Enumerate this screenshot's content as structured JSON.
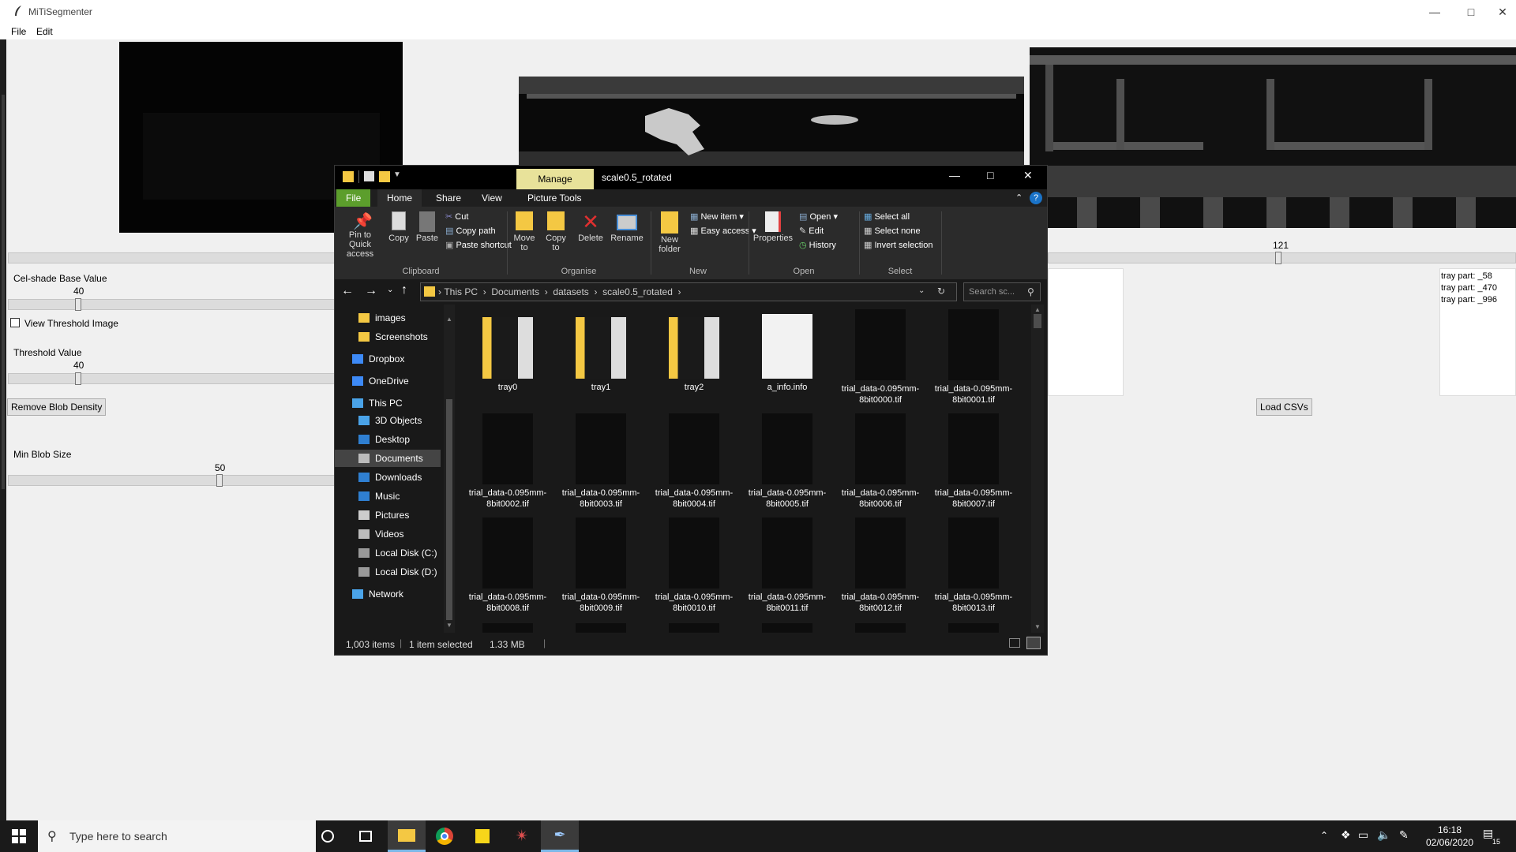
{
  "app": {
    "title": "MiTiSegmenter",
    "menu": [
      "File",
      "Edit"
    ],
    "controls": {
      "top_slider_value": "121",
      "cel_shade_label": "Cel-shade Base Value",
      "cel_shade_value": "40",
      "view_threshold_label": "View Threshold Image",
      "threshold_label": "Threshold Value",
      "threshold_value": "40",
      "remove_blob_button": "Remove Blob Density",
      "min_blob_label": "Min Blob Size",
      "min_blob_value": "50",
      "load_csvs_button": "Load CSVs"
    },
    "tray_parts": [
      "tray part: _58",
      "tray part: _470",
      "tray part: _996"
    ]
  },
  "explorer": {
    "manage_tab": "Manage",
    "title": "scale0.5_rotated",
    "tabs": [
      "File",
      "Home",
      "Share",
      "View",
      "Picture Tools"
    ],
    "ribbon": {
      "clipboard": {
        "pin": "Pin to Quick access",
        "copy": "Copy",
        "paste": "Paste",
        "cut": "Cut",
        "copy_path": "Copy path",
        "paste_shortcut": "Paste shortcut",
        "group": "Clipboard"
      },
      "organise": {
        "move_to": "Move to",
        "copy_to": "Copy to",
        "delete": "Delete",
        "rename": "Rename",
        "group": "Organise"
      },
      "new": {
        "new_folder": "New folder",
        "new_item": "New item",
        "easy_access": "Easy access",
        "group": "New"
      },
      "open": {
        "properties": "Properties",
        "open": "Open",
        "edit": "Edit",
        "history": "History",
        "group": "Open"
      },
      "select": {
        "select_all": "Select all",
        "select_none": "Select none",
        "invert": "Invert selection",
        "group": "Select"
      }
    },
    "breadcrumb": [
      "This PC",
      "Documents",
      "datasets",
      "scale0.5_rotated"
    ],
    "search_placeholder": "Search sc...",
    "nav": [
      {
        "label": "images",
        "icon": "folder-icon",
        "indent": 1
      },
      {
        "label": "Screenshots",
        "icon": "folder-icon",
        "indent": 1
      },
      {
        "label": "Dropbox",
        "icon": "dropbox-icon",
        "indent": 0
      },
      {
        "label": "OneDrive",
        "icon": "onedrive-icon",
        "indent": 0
      },
      {
        "label": "This PC",
        "icon": "pc-icon",
        "indent": 0
      },
      {
        "label": "3D Objects",
        "icon": "cube-icon",
        "indent": 1
      },
      {
        "label": "Desktop",
        "icon": "desktop-icon",
        "indent": 1
      },
      {
        "label": "Documents",
        "icon": "documents-icon",
        "indent": 1,
        "selected": true
      },
      {
        "label": "Downloads",
        "icon": "download-icon",
        "indent": 1
      },
      {
        "label": "Music",
        "icon": "music-icon",
        "indent": 1
      },
      {
        "label": "Pictures",
        "icon": "pictures-icon",
        "indent": 1
      },
      {
        "label": "Videos",
        "icon": "videos-icon",
        "indent": 1
      },
      {
        "label": "Local Disk (C:)",
        "icon": "disk-icon",
        "indent": 1
      },
      {
        "label": "Local Disk (D:)",
        "icon": "disk-icon",
        "indent": 1
      },
      {
        "label": "Network",
        "icon": "network-icon",
        "indent": 0
      }
    ],
    "items": [
      {
        "name": "tray0",
        "kind": "folder"
      },
      {
        "name": "tray1",
        "kind": "folder"
      },
      {
        "name": "tray2",
        "kind": "folder"
      },
      {
        "name": "a_info.info",
        "kind": "file"
      },
      {
        "name": "trial_data-0.095mm-8bit0000.tif",
        "kind": "image"
      },
      {
        "name": "trial_data-0.095mm-8bit0001.tif",
        "kind": "image"
      },
      {
        "name": "trial_data-0.095mm-8bit0002.tif",
        "kind": "image"
      },
      {
        "name": "trial_data-0.095mm-8bit0003.tif",
        "kind": "image"
      },
      {
        "name": "trial_data-0.095mm-8bit0004.tif",
        "kind": "image"
      },
      {
        "name": "trial_data-0.095mm-8bit0005.tif",
        "kind": "image"
      },
      {
        "name": "trial_data-0.095mm-8bit0006.tif",
        "kind": "image"
      },
      {
        "name": "trial_data-0.095mm-8bit0007.tif",
        "kind": "image"
      },
      {
        "name": "trial_data-0.095mm-8bit0008.tif",
        "kind": "image"
      },
      {
        "name": "trial_data-0.095mm-8bit0009.tif",
        "kind": "image"
      },
      {
        "name": "trial_data-0.095mm-8bit0010.tif",
        "kind": "image"
      },
      {
        "name": "trial_data-0.095mm-8bit0011.tif",
        "kind": "image"
      },
      {
        "name": "trial_data-0.095mm-8bit0012.tif",
        "kind": "image"
      },
      {
        "name": "trial_data-0.095mm-8bit0013.tif",
        "kind": "image"
      }
    ],
    "status": {
      "count": "1,003 items",
      "selected": "1 item selected",
      "size": "1.33 MB"
    }
  },
  "taskbar": {
    "search_placeholder": "Type here to search",
    "time": "16:18",
    "date": "02/06/2020",
    "notification_count": "15"
  },
  "colors": {
    "ribbon_file_tab": "#5c9e2c",
    "manage_tab": "#e8e29a",
    "explorer_bg": "#191919",
    "taskbar_bg": "#1a1a1a"
  }
}
